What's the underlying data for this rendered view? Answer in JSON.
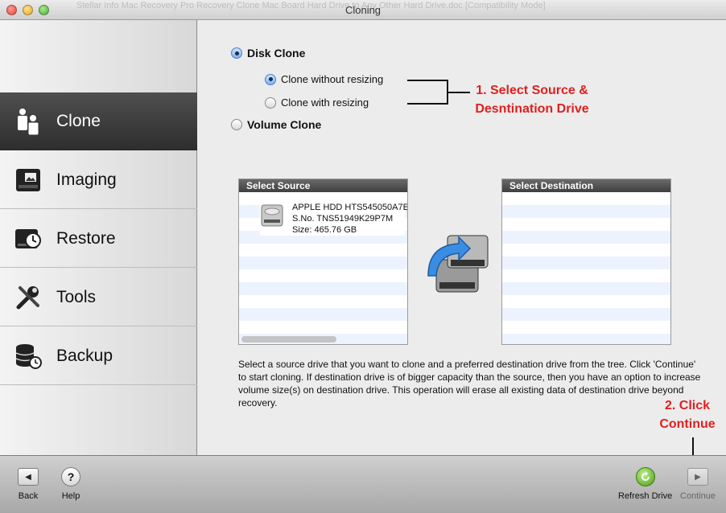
{
  "window": {
    "title": "Cloning",
    "ghost_title": "Stellar Info Mac Recovery Pro Recovery Clone Mac Board Hard Drive to Any Other Hard Drive.doc [Compatibility Mode]"
  },
  "sidebar": {
    "items": [
      {
        "label": "Clone",
        "icon": "clone-icon",
        "active": true
      },
      {
        "label": "Imaging",
        "icon": "imaging-icon",
        "active": false
      },
      {
        "label": "Restore",
        "icon": "restore-icon",
        "active": false
      },
      {
        "label": "Tools",
        "icon": "tools-icon",
        "active": false
      },
      {
        "label": "Backup",
        "icon": "backup-icon",
        "active": false
      }
    ]
  },
  "options": {
    "disk_clone": {
      "label": "Disk Clone",
      "checked": true
    },
    "clone_without_resizing": {
      "label": "Clone without resizing",
      "checked": true
    },
    "clone_with_resizing": {
      "label": "Clone with resizing",
      "checked": false
    },
    "volume_clone": {
      "label": "Volume Clone",
      "checked": false
    }
  },
  "annotations": {
    "step1_line1": "1. Select Source &",
    "step1_line2": "Desntination Drive",
    "step2_line1": "2. Click",
    "step2_line2": "Continue"
  },
  "source": {
    "header": "Select Source",
    "drive": {
      "name": "APPLE HDD HTS545050A7E",
      "serial": "S.No. TNS51949K29P7M",
      "size": "Size: 465.76 GB"
    }
  },
  "destination": {
    "header": "Select Destination"
  },
  "description": "Select a source drive that you want to clone and a preferred destination drive from the tree. Click 'Continue' to start cloning. If destination drive is of bigger capacity than the source, then you have an option to increase volume size(s) on destination drive. This operation will erase all existing data of destination drive beyond recovery.",
  "toolbar": {
    "back": "Back",
    "help": "Help",
    "refresh": "Refresh Drive",
    "continue": "Continue"
  },
  "colors": {
    "annotation": "#e02020",
    "active_nav": "#3a3a3a",
    "list_stripe": "#edf3fe"
  }
}
